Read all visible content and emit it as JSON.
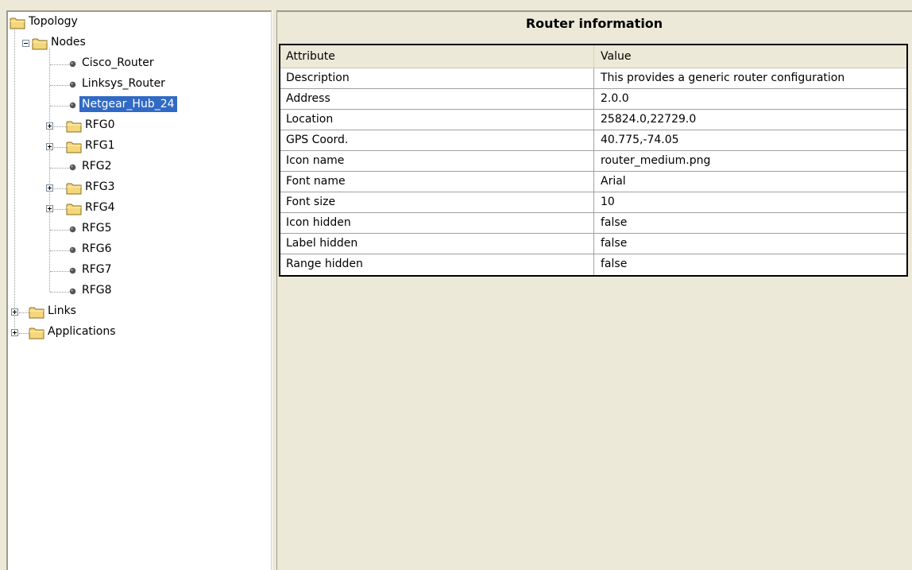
{
  "tree": {
    "root": {
      "label": "Topology"
    },
    "nodes_folder": {
      "label": "Nodes"
    },
    "nodes": [
      {
        "label": "Cisco_Router"
      },
      {
        "label": "Linksys_Router"
      },
      {
        "label": "Netgear_Hub_24",
        "selected": true
      },
      {
        "label": "RFG0",
        "type": "folder"
      },
      {
        "label": "RFG1",
        "type": "folder"
      },
      {
        "label": "RFG2"
      },
      {
        "label": "RFG3",
        "type": "folder"
      },
      {
        "label": "RFG4",
        "type": "folder"
      },
      {
        "label": "RFG5"
      },
      {
        "label": "RFG6"
      },
      {
        "label": "RFG7"
      },
      {
        "label": "RFG8"
      }
    ],
    "links_folder": {
      "label": "Links"
    },
    "applications_folder": {
      "label": "Applications"
    }
  },
  "info": {
    "title": "Router information",
    "columns": {
      "attribute": "Attribute",
      "value": "Value"
    },
    "rows": [
      {
        "attribute": "Description",
        "value": "This provides a generic router configuration"
      },
      {
        "attribute": "Address",
        "value": "2.0.0"
      },
      {
        "attribute": "Location",
        "value": "25824.0,22729.0"
      },
      {
        "attribute": "GPS Coord.",
        "value": "40.775,-74.05"
      },
      {
        "attribute": "Icon name",
        "value": "router_medium.png"
      },
      {
        "attribute": "Font name",
        "value": "Arial"
      },
      {
        "attribute": "Font size",
        "value": "10"
      },
      {
        "attribute": "Icon hidden",
        "value": "false"
      },
      {
        "attribute": "Label hidden",
        "value": "false"
      },
      {
        "attribute": "Range hidden",
        "value": "false"
      }
    ]
  },
  "colors": {
    "selection": "#316ac5",
    "folder_fill": "#f5d77a",
    "panel_bg": "#ece9d8"
  }
}
